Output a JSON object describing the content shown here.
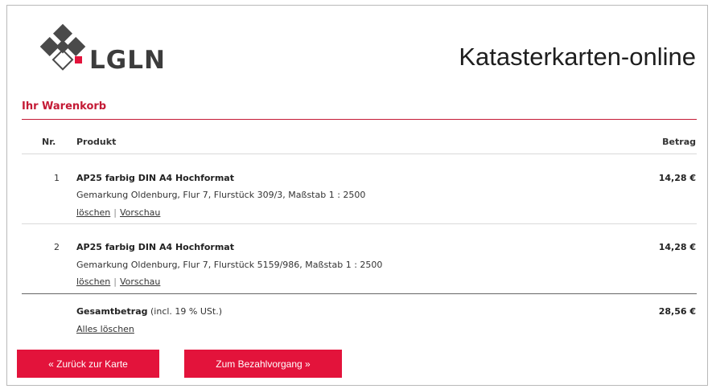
{
  "header": {
    "logo_text": "LGLN",
    "app_title": "Katasterkarten-online"
  },
  "cart": {
    "title": "Ihr Warenkorb",
    "columns": {
      "nr": "Nr.",
      "product": "Produkt",
      "amount": "Betrag"
    },
    "items": [
      {
        "nr": "1",
        "name": "AP25 farbig DIN A4 Hochformat",
        "description": "Gemarkung Oldenburg, Flur 7, Flurstück 309/3, Maßstab 1 : 2500",
        "delete_label": "löschen",
        "preview_label": "Vorschau",
        "separator": "|",
        "price": "14,28 €"
      },
      {
        "nr": "2",
        "name": "AP25 farbig DIN A4 Hochformat",
        "description": "Gemarkung Oldenburg, Flur 7, Flurstück 5159/986, Maßstab 1 : 2500",
        "delete_label": "löschen",
        "preview_label": "Vorschau",
        "separator": "|",
        "price": "14,28 €"
      }
    ],
    "total": {
      "label": "Gesamtbetrag",
      "note": " (incl. 19 % USt.)",
      "amount": "28,56 €",
      "delete_all_label": "Alles löschen"
    }
  },
  "buttons": {
    "back": "« Zurück zur Karte",
    "checkout": "Zum Bezahlvorgang »"
  },
  "colors": {
    "accent": "#e3133b",
    "heading": "#c41a35",
    "logo_gray": "#3c3c3c"
  }
}
